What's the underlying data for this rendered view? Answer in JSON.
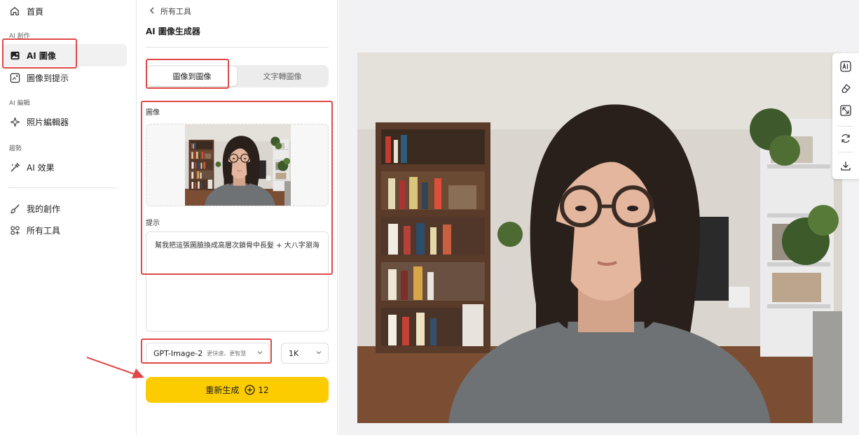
{
  "sidebar": {
    "home": "首頁",
    "sec_create": "AI 創作",
    "ai_image": "AI 圖像",
    "image_to_prompt": "圖像到提示",
    "sec_edit": "AI 編輯",
    "photo_editor": "照片編輯器",
    "sec_trend": "趨勢",
    "ai_effects": "AI 效果",
    "my_creations": "我的創作",
    "all_tools": "所有工具"
  },
  "panel": {
    "back_label": "所有工具",
    "title": "AI 圖像生成器",
    "tabs": [
      {
        "label": "圖像到圖像",
        "active": true
      },
      {
        "label": "文字轉圖像",
        "active": false
      }
    ],
    "image_label": "圖像",
    "prompt_label": "提示",
    "prompt_value": "幫我把這張圖臉換成高層次鎖骨中長髮 + 大八字瀏海",
    "model": {
      "name": "GPT-Image-2",
      "desc": "更快速、更智慧"
    },
    "resolution": "1K",
    "generate_label": "重新生成",
    "credits": "12"
  },
  "colors": {
    "accent": "#fccb00",
    "highlight": "#e04848"
  },
  "toolbar_icons": [
    "ai-enhance-icon",
    "eraser-icon",
    "expand-icon",
    "regenerate-icon",
    "download-icon"
  ]
}
